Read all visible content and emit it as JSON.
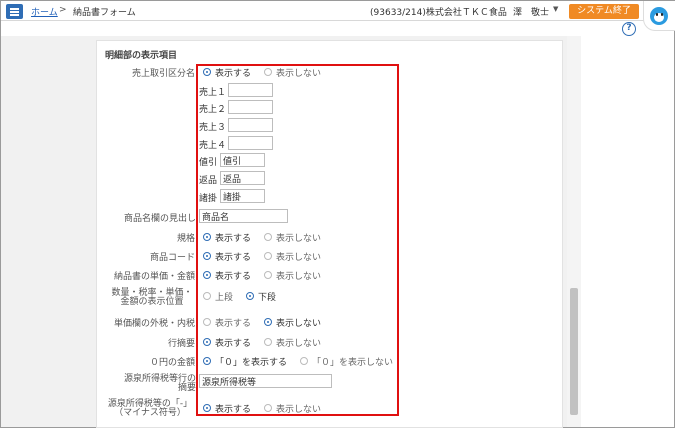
{
  "header": {
    "home": "ホーム",
    "sep": ">",
    "page": "納品書フォーム",
    "company": "(93633/214)株式会社ＴＫＣ食品",
    "user": "澤　敬士",
    "user_caret": "▼",
    "exit": "システム終了",
    "help": "?"
  },
  "section": {
    "title": "明細部の表示項目"
  },
  "rows": {
    "sales_kind": {
      "label": "売上取引区分名",
      "opt1": "表示する",
      "opt2": "表示しない",
      "selected": 1
    },
    "uriage1": {
      "label": "売上１",
      "value": ""
    },
    "uriage2": {
      "label": "売上２",
      "value": ""
    },
    "uriage3": {
      "label": "売上３",
      "value": ""
    },
    "uriage4": {
      "label": "売上４",
      "value": ""
    },
    "nebiki": {
      "label": "値引",
      "value": "値引"
    },
    "henpin": {
      "label": "返品",
      "value": "返品"
    },
    "shokake": {
      "label": "諸掛",
      "value": "諸掛"
    },
    "item_heading": {
      "label": "商品名欄の見出し",
      "value": "商品名"
    },
    "kikaku": {
      "label": "規格",
      "opt1": "表示する",
      "opt2": "表示しない",
      "selected": 1
    },
    "item_code": {
      "label": "商品コード",
      "opt1": "表示する",
      "opt2": "表示しない",
      "selected": 1
    },
    "unit_price_amount": {
      "label": "納品書の単価・金額",
      "opt1": "表示する",
      "opt2": "表示しない",
      "selected": 1
    },
    "position": {
      "label_line1": "数量・税率・単価・",
      "label_line2": "金額の表示位置",
      "opt1": "上段",
      "opt2": "下段",
      "selected": 2
    },
    "tax_incl": {
      "label": "単価欄の外税・内税",
      "opt1": "表示する",
      "opt2": "表示しない",
      "selected": 2
    },
    "line_memo": {
      "label": "行摘要",
      "opt1": "表示する",
      "opt2": "表示しない",
      "selected": 1
    },
    "zero_amount": {
      "label": "０円の金額",
      "opt1": "「０」を表示する",
      "opt2": "「０」を表示しない",
      "selected": 1
    },
    "withholding_memo": {
      "label_line1": "源泉所得税等行の",
      "label_line2": "摘要",
      "value": "源泉所得税等"
    },
    "withholding_minus": {
      "label_line1": "源泉所得税等の「-」",
      "label_line2": "（マイナス符号）",
      "opt1": "表示する",
      "opt2": "表示しない",
      "selected": 1
    }
  },
  "colors": {
    "accent": "#2f6db5",
    "exit": "#f08a24",
    "highlight": "#e01010"
  }
}
